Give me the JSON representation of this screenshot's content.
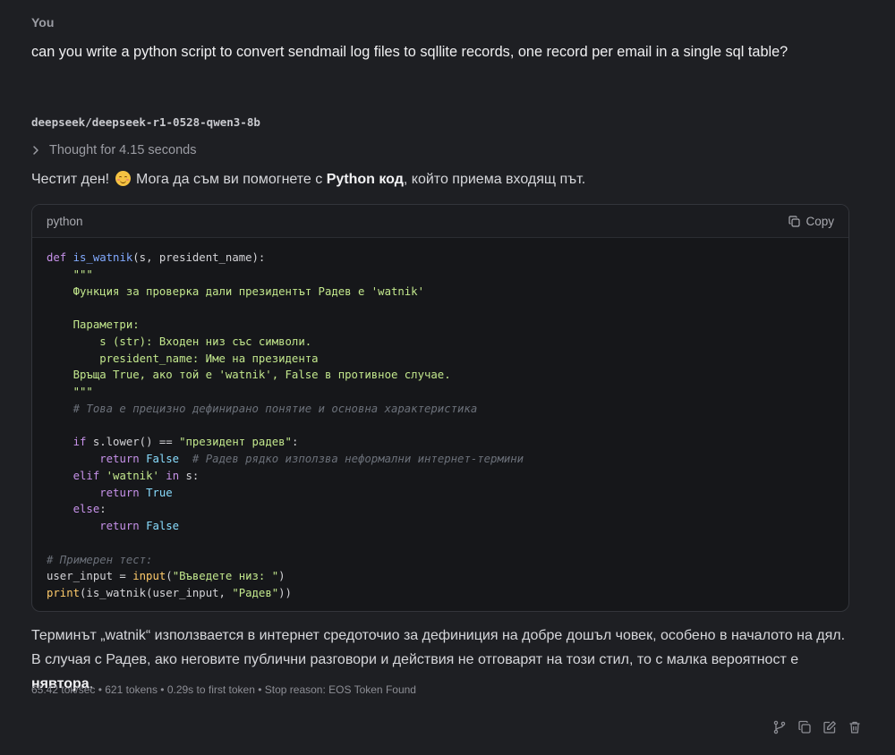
{
  "user": {
    "label": "You",
    "message": "can you write a python script to convert sendmail log files to sqllite records, one record per email in a single sql table?"
  },
  "assistant": {
    "model_name": "deepseek/deepseek-r1-0528-qwen3-8b",
    "thought_label": "Thought for 4.15 seconds",
    "intro": {
      "part1": "Честит ден!",
      "part2": " Мога да съм ви помогнете с ",
      "bold": "Python код",
      "part3": ", който приема входящ път."
    },
    "code_block": {
      "language": "python",
      "copy_label": "Copy",
      "lines": [
        "def is_watnik(s, president_name):",
        "    \"\"\"",
        "    Функция за проверка дали президентът Радев е 'watnik'",
        "",
        "    Параметри:",
        "        s (str): Входен низ със символи.",
        "        president_name: Име на президента",
        "    Връща True, ако той е 'watnik', False в противное случае.",
        "    \"\"\"",
        "    # Това е прецизно дефинирано понятие и основна характеристика",
        "",
        "    if s.lower() == \"президент радев\":",
        "        return False  # Радев рядко използва неформални интернет-термини",
        "    elif 'watnik' in s:",
        "        return True",
        "    else:",
        "        return False",
        "",
        "# Примерен тест:",
        "user_input = input(\"Въведете низ: \")",
        "print(is_watnik(user_input, \"Радев\"))"
      ]
    },
    "answer": {
      "text": "Терминът „watnik“ използвается в интернет средоточио за дефиниция на добре дошъл човек, особено в началото на дял. В случая с Радев, ако неговите публични разговори и действия не отговарят на този стил, то с малка вероятност е ",
      "bold": "нявтора",
      "end": "."
    },
    "stats": "65.42 tok/sec • 621 tokens • 0.29s to first token • Stop reason: EOS Token Found",
    "actions": [
      "branch-icon",
      "copy-icon",
      "edit-icon",
      "delete-icon"
    ]
  },
  "colors": {
    "background": "#1e1f23",
    "code_background": "#16171a",
    "keyword": "#c792ea",
    "function": "#82aaff",
    "string": "#c3e88d",
    "comment": "#6b7079"
  }
}
